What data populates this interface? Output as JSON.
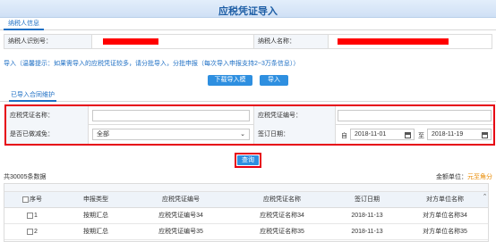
{
  "page": {
    "title": "应税凭证导入"
  },
  "taxpayer_tab": {
    "label": "纳税人信息"
  },
  "taxpayer_info": {
    "id_label": "纳税人识别号：",
    "name_label": "纳税人名称："
  },
  "import_hint": "导入（温馨提示：如果需导入的应税凭证较多，请分批导入，分批申报（每次导入申报支持2~3万条信息））",
  "buttons": {
    "download_template": "下载导入模板",
    "import": "导入",
    "query": "查询"
  },
  "contract_tab": {
    "label": "已导入合同维护"
  },
  "search": {
    "voucher_name_label": "应税凭证名称：",
    "voucher_name_value": "",
    "voucher_no_label": "应税凭证编号：",
    "voucher_no_value": "",
    "reduced_label": "是否已做减免：",
    "reduced_value": "全部",
    "sign_date_label": "签订日期：",
    "date_from_prefix": "自",
    "date_from": "2018-11-01",
    "date_to_prefix": "至",
    "date_to": "2018-11-19"
  },
  "result": {
    "count_text": "共30005条数据",
    "unit_label": "金额单位：",
    "unit_value": "元至角分"
  },
  "table": {
    "columns": [
      "序号",
      "申报类型",
      "应税凭证编号",
      "应税凭证名称",
      "签订日期",
      "对方单位名称"
    ],
    "rows": [
      [
        "1",
        "按期汇总",
        "应税凭证编号34",
        "应税凭证名称34",
        "2018-11-13",
        "对方单位名称34"
      ],
      [
        "2",
        "按期汇总",
        "应税凭证编号35",
        "应税凭证名称35",
        "2018-11-13",
        "对方单位名称35"
      ]
    ]
  },
  "colors": {
    "accent": "#2e8fe0",
    "highlight_border": "#e60012",
    "redaction": "#ff0000",
    "title_text": "#1f5fa6"
  },
  "icons": [
    "calendar-icon",
    "chevron-down-icon",
    "checkbox-icon",
    "scroll-up-icon"
  ]
}
